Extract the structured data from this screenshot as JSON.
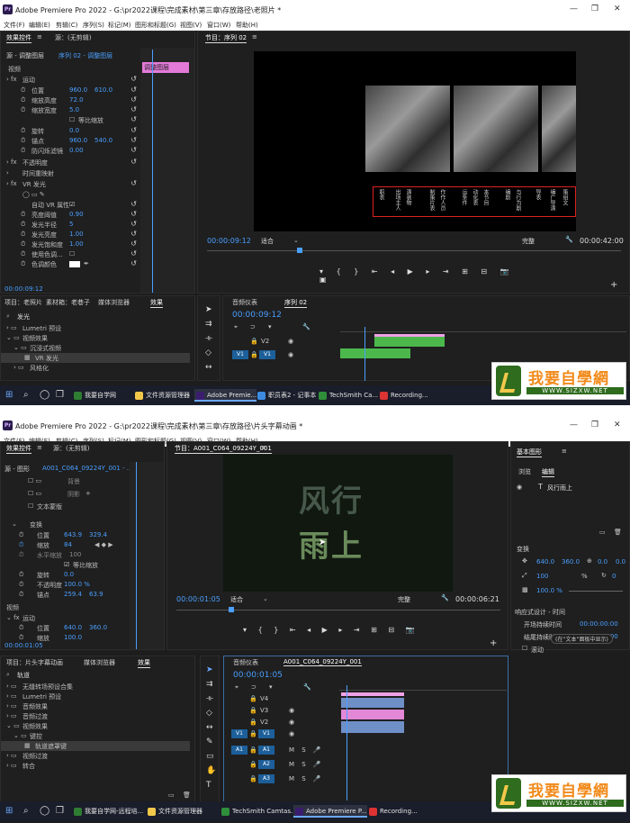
{
  "top": {
    "window_title": "Adobe Premiere Pro 2022 - G:\\pr2022课程\\完成素材\\第三章\\存放路径\\老照片 *",
    "menu": [
      "文件(F)",
      "编辑(E)",
      "剪辑(C)",
      "序列(S)",
      "标记(M)",
      "图形和标题(G)",
      "视图(V)",
      "窗口(W)",
      "帮助(H)"
    ],
    "effect_controls": {
      "tab_label": "效果控件",
      "tab_menu": "≡",
      "source_tab": "源：(无剪辑)",
      "source_path": "源 - 调整图层",
      "sequence_path": "序列 02 - 调整图层",
      "clip_label": "调整图层",
      "section_video": "视频",
      "motion": "运动",
      "props": [
        {
          "label": "位置",
          "v1": "960.0",
          "v2": "610.0"
        },
        {
          "label": "缩放高度",
          "v1": "72.0",
          "v2": ""
        },
        {
          "label": "缩放宽度",
          "v1": "5.0",
          "v2": ""
        },
        {
          "label": "等比缩放",
          "v1": "",
          "v2": ""
        },
        {
          "label": "旋转",
          "v1": "0.0",
          "v2": ""
        },
        {
          "label": "锚点",
          "v1": "960.0",
          "v2": "540.0"
        },
        {
          "label": "防闪烁滤镜",
          "v1": "0.00",
          "v2": ""
        }
      ],
      "opacity": "不透明度",
      "time_remap": "时间重映射",
      "vr_glow": "VR 发光",
      "auto_vr": "自动 VR 属性",
      "glow_props": [
        {
          "label": "亮度阈值",
          "v": "0.90"
        },
        {
          "label": "发光半径",
          "v": "5"
        },
        {
          "label": "发光亮度",
          "v": "1.00"
        },
        {
          "label": "发光饱和度",
          "v": "1.00"
        },
        {
          "label": "使用色调...",
          "v": ""
        },
        {
          "label": "色调颜色",
          "v": ""
        }
      ],
      "timecode": "00:00:09:12"
    },
    "program": {
      "title": "节目：序列 02",
      "tab_menu": "≡",
      "credits": [
        "职表",
        "出场主人",
        "演装物",
        "制策片表",
        "作作人员",
        "运条件",
        "动化表",
        "本节目",
        "编剧",
        "与行为剧",
        "导表",
        "编广导演",
        "策组文"
      ],
      "timecode": "00:00:09:12",
      "fit": "适合",
      "quality": "完整",
      "duration": "00:00:42:00"
    },
    "project": {
      "tabs": [
        "项目：老照片",
        "素材箱：老巷子",
        "媒体浏览器",
        "效果"
      ],
      "search": "发光",
      "tree": [
        "Lumetri 预设",
        "视频效果",
        "沉浸式视频",
        "VR 发光",
        "风格化"
      ]
    },
    "timeline": {
      "tabs": [
        "音频仪表",
        "序列 02"
      ],
      "timecode": "00:00:09:12",
      "tracks": [
        "V2",
        "V1"
      ]
    },
    "taskbar": [
      "我要自学网",
      "文件资源管理器",
      "Adobe Premie...",
      "职员表2 - 记事本",
      "TechSmith Ca...",
      "Recording..."
    ]
  },
  "bottom": {
    "window_title": "Adobe Premiere Pro 2022 - G:\\pr2022课程\\完成素材\\第三章\\存放路径\\片头字幕动画 *",
    "menu": [
      "文件(F)",
      "编辑(E)",
      "剪辑(C)",
      "序列(S)",
      "标记(M)",
      "图形和标题(G)",
      "视图(V)",
      "窗口(W)",
      "帮助(H)"
    ],
    "effect_controls": {
      "tab_label": "效果控件",
      "tab_menu": "≡",
      "source_tab": "源：(无剪辑)",
      "source_path": "源 - 图形",
      "sequence_path": "A001_C064_09224Y_001 - ...",
      "text_items": [
        "背景",
        "阴影",
        "文本蒙版"
      ],
      "transform": "变换",
      "props": [
        {
          "label": "位置",
          "v1": "643.9",
          "v2": "329.4"
        },
        {
          "label": "缩放",
          "v1": "84",
          "v2": ""
        },
        {
          "label": "水平缩放",
          "v1": "100",
          "v2": ""
        },
        {
          "label": "等比缩放",
          "v1": "",
          "v2": ""
        },
        {
          "label": "旋转",
          "v1": "0.0",
          "v2": ""
        },
        {
          "label": "不透明度",
          "v1": "100.0 %",
          "v2": ""
        },
        {
          "label": "锚点",
          "v1": "259.4",
          "v2": "63.9"
        }
      ],
      "section_video": "视频",
      "motion": "运动",
      "motion_props": [
        {
          "label": "位置",
          "v1": "640.0",
          "v2": "360.0"
        },
        {
          "label": "缩放",
          "v1": "100.0",
          "v2": ""
        }
      ],
      "timecode": "00:00:01:05"
    },
    "program": {
      "title": "节目：A001_C064_09224Y_001",
      "tab_menu": "≡",
      "big_text": [
        "风行",
        "雨上"
      ],
      "timecode": "00:00:01:05",
      "fit": "适合",
      "quality": "完整",
      "duration": "00:00:06:21"
    },
    "essential_graphics": {
      "title": "基本图形",
      "tab_browse": "浏览",
      "tab_edit": "编辑",
      "layer": "风行雨上",
      "transform": "变换",
      "pos_x": "640.0",
      "pos_y": "360.0",
      "anchor_x": "0.0",
      "anchor_y": "0.0",
      "scale": "100",
      "scale_unit": "%",
      "rotate": "0",
      "opacity": "100.0 %",
      "responsive": "响应式设计 - 时间",
      "start_lbl": "开场持续时间",
      "start_val": "00:00:00:00",
      "end_lbl": "结尾持续时间",
      "end_val": "00:00:00:00",
      "roll": "滚动",
      "note": "(在“文本”面板中显示)"
    },
    "project": {
      "tabs": [
        "项目：片头字幕动画",
        "媒体浏览器",
        "效果"
      ],
      "search": "轨道",
      "tree": [
        "无缝转场预设合集",
        "Lumetri 预设",
        "音频效果",
        "音频过渡",
        "视频效果",
        "键控",
        "轨道遮罩键",
        "视频过渡",
        "转合"
      ]
    },
    "timeline": {
      "tabs": [
        "音频仪表",
        "A001_C064_09224Y_001"
      ],
      "timecode": "00:00:01:05",
      "tracks": [
        "V4",
        "V3",
        "V2",
        "V1",
        "A1",
        "A2",
        "A3"
      ]
    },
    "taskbar": [
      "我要自学网-远程培...",
      "文件资源管理器",
      "TechSmith Camtas...",
      "Adobe Premiere P...",
      "Recording..."
    ]
  },
  "watermark": {
    "big": "我要自學網",
    "small": "WWW.SIZXW.NET"
  }
}
